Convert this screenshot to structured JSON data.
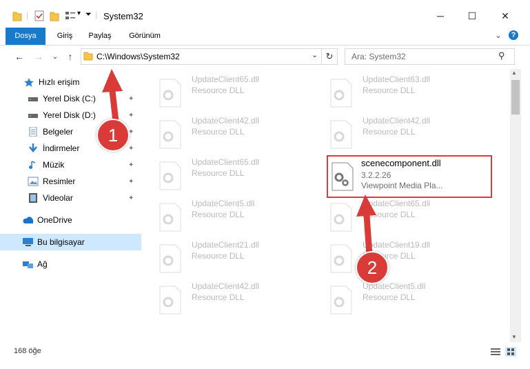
{
  "window": {
    "title": "System32",
    "minimize": "─",
    "maximize": "☐",
    "close": "✕"
  },
  "ribbon": {
    "tabs": [
      "Dosya",
      "Giriş",
      "Paylaş",
      "Görünüm"
    ],
    "expand": "⌄",
    "help": "?"
  },
  "nav": {
    "back": "←",
    "forward": "→",
    "recent": "⌄",
    "up": "↑",
    "refresh": "↻",
    "dropdown": "⌄"
  },
  "address": {
    "path": "C:\\Windows\\System32"
  },
  "search": {
    "placeholder": "Ara: System32",
    "icon": "⚲"
  },
  "sidebar": {
    "quick_access": "Hızlı erişim",
    "items": [
      {
        "label": "Yerel Disk (C:)",
        "icon": "drive-icon"
      },
      {
        "label": "Yerel Disk (D:)",
        "icon": "drive-icon"
      },
      {
        "label": "Belgeler",
        "icon": "documents-icon"
      },
      {
        "label": "İndirmeler",
        "icon": "downloads-icon"
      },
      {
        "label": "Müzik",
        "icon": "music-icon"
      },
      {
        "label": "Resimler",
        "icon": "pictures-icon"
      },
      {
        "label": "Videolar",
        "icon": "videos-icon"
      }
    ],
    "onedrive": "OneDrive",
    "this_pc": "Bu bilgisayar",
    "network": "Ağ",
    "pin_glyph": "📌"
  },
  "files": {
    "left": [
      {
        "name": "UpdateClient65.dll",
        "type": "Resource DLL"
      },
      {
        "name": "UpdateClient42.dll",
        "type": "Resource DLL"
      },
      {
        "name": "UpdateClient65.dll",
        "type": "Resource DLL"
      },
      {
        "name": "UpdateClient5.dll",
        "type": "Resource DLL"
      },
      {
        "name": "UpdateClient21.dll",
        "type": "Resource DLL"
      },
      {
        "name": "UpdateClient42.dll",
        "type": "Resource DLL"
      }
    ],
    "right": [
      {
        "name": "UpdateClient63.dll",
        "type": "Resource DLL"
      },
      {
        "name": "UpdateClient42.dll",
        "type": "Resource DLL"
      },
      {
        "name": "UpdateClient65.dll",
        "type": "Resource DLL"
      },
      {
        "name": "UpdateClient19.dll",
        "type": "Resource DLL"
      },
      {
        "name": "UpdateClient5.dll",
        "type": "Resource DLL"
      }
    ],
    "highlight": {
      "name": "scenecomponent.dll",
      "version": "3.2.2.26",
      "description": "Viewpoint Media Pla..."
    }
  },
  "annotations": {
    "step1": "1",
    "step2": "2",
    "color": "#d93b38"
  },
  "status": {
    "count": "168 öğe"
  }
}
